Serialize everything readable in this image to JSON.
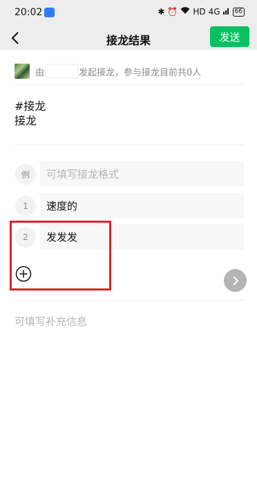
{
  "status_bar": {
    "time": "20:02",
    "icons": [
      "bluetooth-icon",
      "alarm-icon",
      "wifi-icon",
      "signal-icon",
      "battery-icon"
    ],
    "hd_label": "HD",
    "signal_label": "4G",
    "battery": "66"
  },
  "header": {
    "title": "接龙结果",
    "send_label": "发送",
    "accent": "#07c160"
  },
  "info": {
    "prefix": "由",
    "suffix": "发起接龙，参与接龙目前共0人"
  },
  "topic": {
    "line1": "#接龙",
    "line2": "接龙"
  },
  "rows": [
    {
      "num": "例",
      "text": "可填写接龙格式",
      "placeholder": true
    },
    {
      "num": "1",
      "text": "速度的",
      "placeholder": false
    },
    {
      "num": "2",
      "text": "发发发",
      "placeholder": false
    }
  ],
  "supplement_placeholder": "可填写补充信息",
  "highlight_color": "#d9242c"
}
